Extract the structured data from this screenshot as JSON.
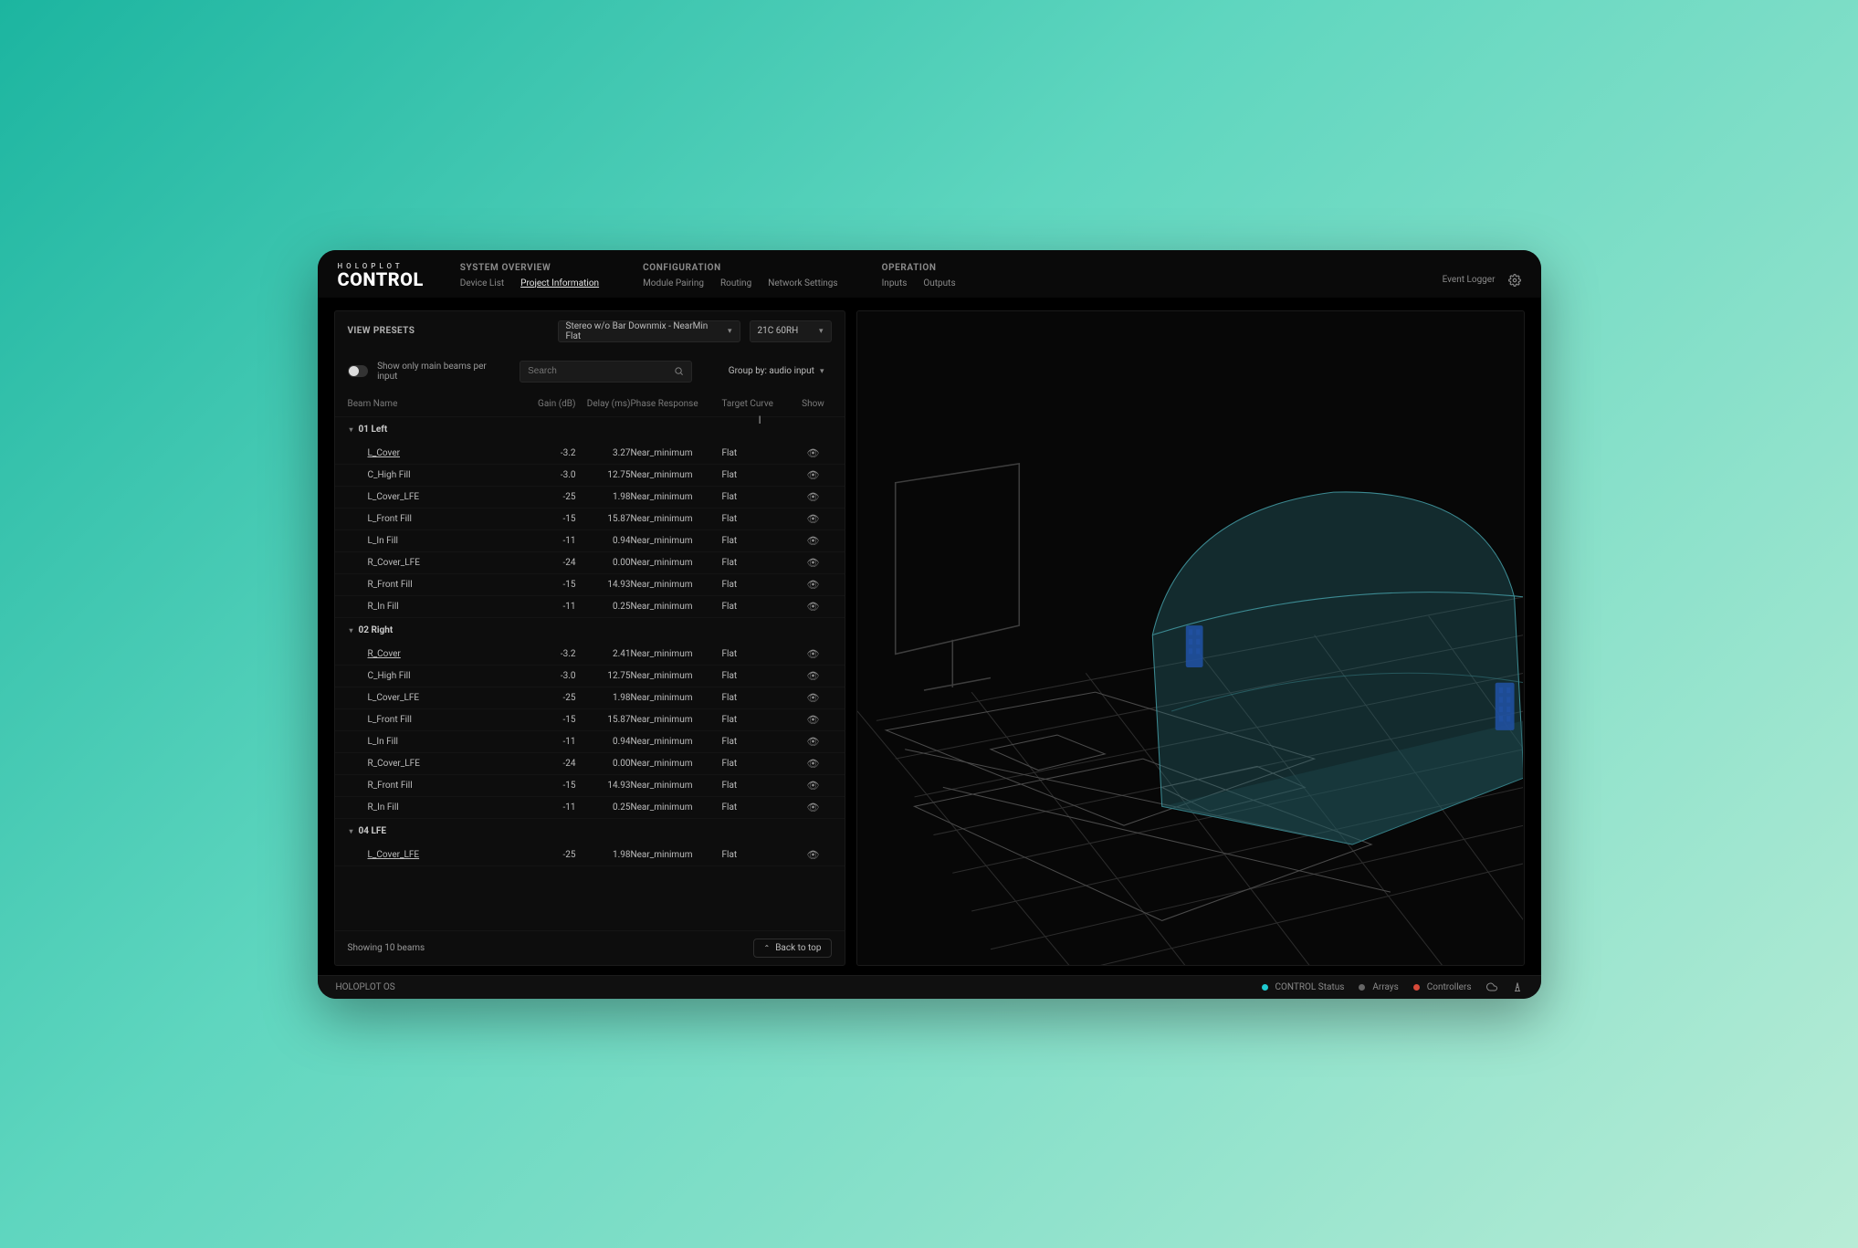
{
  "brand": {
    "sub": "HOLOPLOT",
    "main": "CONTROL"
  },
  "nav": {
    "groups": [
      {
        "title": "SYSTEM OVERVIEW",
        "items": [
          "Device List",
          "Project Information"
        ],
        "active": 1
      },
      {
        "title": "CONFIGURATION",
        "items": [
          "Module Pairing",
          "Routing",
          "Network Settings"
        ],
        "active": -1
      },
      {
        "title": "OPERATION",
        "items": [
          "Inputs",
          "Outputs"
        ],
        "active": -1
      }
    ],
    "right": {
      "event_logger": "Event Logger"
    }
  },
  "left_panel": {
    "view_presets_label": "VIEW PRESETS",
    "preset_selected": "Stereo w/o Bar Downmix - NearMin Flat",
    "variant_selected": "21C 60RH",
    "toggle_label": "Show only main beams per input",
    "search_placeholder": "Search",
    "group_by_label": "Group by: audio input",
    "columns": {
      "beam_name": "Beam Name",
      "gain": "Gain (dB)",
      "delay": "Delay (ms)",
      "phase": "Phase Response",
      "target": "Target Curve",
      "show": "Show"
    },
    "groups": [
      {
        "name": "01 Left",
        "rows": [
          {
            "name": "L_Cover",
            "u": true,
            "gain": "-3.2",
            "delay": "3.27",
            "phase": "Near_minimum",
            "target": "Flat"
          },
          {
            "name": "C_High Fill",
            "u": false,
            "gain": "-3.0",
            "delay": "12.75",
            "phase": "Near_minimum",
            "target": "Flat"
          },
          {
            "name": "L_Cover_LFE",
            "u": false,
            "gain": "-25",
            "delay": "1.98",
            "phase": "Near_minimum",
            "target": "Flat"
          },
          {
            "name": "L_Front Fill",
            "u": false,
            "gain": "-15",
            "delay": "15.87",
            "phase": "Near_minimum",
            "target": "Flat"
          },
          {
            "name": "L_In Fill",
            "u": false,
            "gain": "-11",
            "delay": "0.94",
            "phase": "Near_minimum",
            "target": "Flat"
          },
          {
            "name": "R_Cover_LFE",
            "u": false,
            "gain": "-24",
            "delay": "0.00",
            "phase": "Near_minimum",
            "target": "Flat"
          },
          {
            "name": "R_Front Fill",
            "u": false,
            "gain": "-15",
            "delay": "14.93",
            "phase": "Near_minimum",
            "target": "Flat"
          },
          {
            "name": "R_In Fill",
            "u": false,
            "gain": "-11",
            "delay": "0.25",
            "phase": "Near_minimum",
            "target": "Flat"
          }
        ]
      },
      {
        "name": "02 Right",
        "rows": [
          {
            "name": "R_Cover",
            "u": true,
            "gain": "-3.2",
            "delay": "2.41",
            "phase": "Near_minimum",
            "target": "Flat"
          },
          {
            "name": "C_High Fill",
            "u": false,
            "gain": "-3.0",
            "delay": "12.75",
            "phase": "Near_minimum",
            "target": "Flat"
          },
          {
            "name": "L_Cover_LFE",
            "u": false,
            "gain": "-25",
            "delay": "1.98",
            "phase": "Near_minimum",
            "target": "Flat"
          },
          {
            "name": "L_Front Fill",
            "u": false,
            "gain": "-15",
            "delay": "15.87",
            "phase": "Near_minimum",
            "target": "Flat"
          },
          {
            "name": "L_In Fill",
            "u": false,
            "gain": "-11",
            "delay": "0.94",
            "phase": "Near_minimum",
            "target": "Flat"
          },
          {
            "name": "R_Cover_LFE",
            "u": false,
            "gain": "-24",
            "delay": "0.00",
            "phase": "Near_minimum",
            "target": "Flat"
          },
          {
            "name": "R_Front Fill",
            "u": false,
            "gain": "-15",
            "delay": "14.93",
            "phase": "Near_minimum",
            "target": "Flat"
          },
          {
            "name": "R_In Fill",
            "u": false,
            "gain": "-11",
            "delay": "0.25",
            "phase": "Near_minimum",
            "target": "Flat"
          }
        ]
      },
      {
        "name": "04 LFE",
        "rows": [
          {
            "name": "L_Cover_LFE",
            "u": true,
            "gain": "-25",
            "delay": "1.98",
            "phase": "Near_minimum",
            "target": "Flat"
          }
        ]
      }
    ],
    "footer": {
      "showing": "Showing 10 beams",
      "back_to_top": "Back to top"
    }
  },
  "statusbar": {
    "os": "HOLOPLOT OS",
    "control_status": "CONTROL Status",
    "arrays": "Arrays",
    "controllers": "Controllers"
  },
  "colors": {
    "accent": "#1fcad1",
    "error": "#d64a3a",
    "building": "#2b6f78"
  }
}
